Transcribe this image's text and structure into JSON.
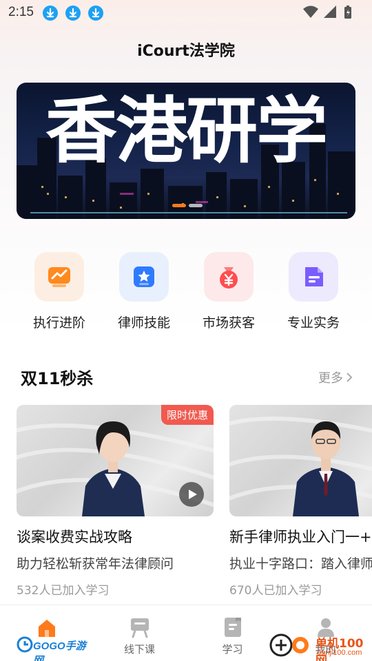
{
  "status_bar": {
    "time": "2:15"
  },
  "app": {
    "title": "iCourt法学院"
  },
  "banner": {
    "text": "香港研学"
  },
  "categories": [
    {
      "label": "执行进阶",
      "icon": "trend-chart-icon",
      "color": "#ff8a1f"
    },
    {
      "label": "律师技能",
      "icon": "star-badge-icon",
      "color": "#2f7bff"
    },
    {
      "label": "市场获客",
      "icon": "money-bag-icon",
      "color": "#ff4d4f"
    },
    {
      "label": "专业实务",
      "icon": "document-icon",
      "color": "#7b5cff"
    }
  ],
  "section": {
    "title": "双11秒杀",
    "more": "更多"
  },
  "courses": [
    {
      "badge": "限时优惠",
      "title": "谈案收费实战攻略",
      "subtitle": "助力轻松斩获常年法律顾问",
      "count": "532人已加入学习"
    },
    {
      "title": "新手律师执业入门一+",
      "subtitle": "执业十字路口：踏入律师",
      "count": "670人已加入学习"
    }
  ],
  "nav": [
    {
      "label": "",
      "icon": "home-icon",
      "active": true
    },
    {
      "label": "线下课",
      "icon": "offline-course-icon"
    },
    {
      "label": "学习",
      "icon": "study-icon"
    },
    {
      "label": "我的",
      "icon": "profile-icon"
    }
  ],
  "watermarks": {
    "left": "GOGO手游网",
    "right": "单机100网",
    "right_sub": "danji100.com"
  },
  "colors": {
    "accent": "#ff7a1a",
    "badge": "#f05a4f",
    "download": "#1da1f2"
  }
}
